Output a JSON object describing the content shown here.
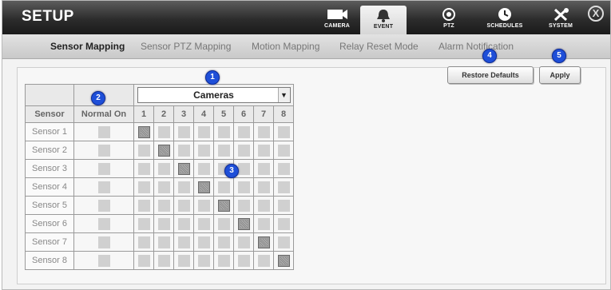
{
  "app_title": "SETUP",
  "nav": [
    {
      "label": "CAMERA",
      "icon": "camera-icon",
      "active": false
    },
    {
      "label": "EVENT",
      "icon": "bell-icon",
      "active": true
    },
    {
      "label": "PTZ",
      "icon": "ptz-icon",
      "active": false
    },
    {
      "label": "SCHEDULES",
      "icon": "clock-icon",
      "active": false
    },
    {
      "label": "SYSTEM",
      "icon": "tools-icon",
      "active": false
    }
  ],
  "close_label": "X",
  "subtabs": [
    {
      "label": "Sensor Mapping",
      "active": true
    },
    {
      "label": "Sensor PTZ Mapping",
      "active": false
    },
    {
      "label": "Motion Mapping",
      "active": false
    },
    {
      "label": "Relay Reset Mode",
      "active": false
    },
    {
      "label": "Alarm Notification",
      "active": false
    }
  ],
  "buttons": {
    "restore": "Restore Defaults",
    "apply": "Apply"
  },
  "table": {
    "cameras_select": "Cameras",
    "sensor_header": "Sensor",
    "normal_on_header": "Normal On",
    "camera_columns": [
      "1",
      "2",
      "3",
      "4",
      "5",
      "6",
      "7",
      "8"
    ],
    "rows": [
      {
        "label": "Sensor 1",
        "mapped_camera": 1
      },
      {
        "label": "Sensor 2",
        "mapped_camera": 2
      },
      {
        "label": "Sensor 3",
        "mapped_camera": 3
      },
      {
        "label": "Sensor 4",
        "mapped_camera": 4
      },
      {
        "label": "Sensor 5",
        "mapped_camera": 5
      },
      {
        "label": "Sensor 6",
        "mapped_camera": 6
      },
      {
        "label": "Sensor 7",
        "mapped_camera": 7
      },
      {
        "label": "Sensor 8",
        "mapped_camera": 8
      }
    ]
  },
  "callouts": [
    "1",
    "2",
    "3",
    "4",
    "5"
  ],
  "colors": {
    "callout": "#1f4fd8",
    "topbar": "#2c2c2c"
  }
}
